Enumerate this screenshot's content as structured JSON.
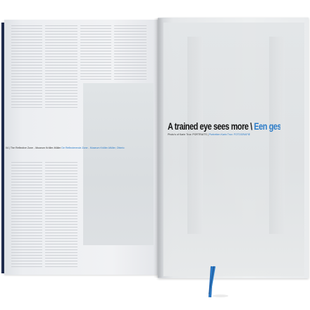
{
  "left_page": {
    "caption_prefix": "04 | The Reflective Zone - Museum Kröller-Müller ",
    "caption_accent": "De Reflecterende Zone - Museum Kröller-Müller, Otterlo"
  },
  "right_page": {
    "headline_black": "A trained eye sees more",
    "headline_separator": "\\",
    "headline_blue": "Een gesc",
    "subcaption_prefix": "Photo's of Karin Trox: PORTRAITS | ",
    "subcaption_accent": "Portretten Karin Trox: FOTOGRAFIE"
  },
  "colors": {
    "accent": "#2a7bc8",
    "ribbon": "#2f85d4",
    "cover_edge": "#1f2c4d"
  }
}
